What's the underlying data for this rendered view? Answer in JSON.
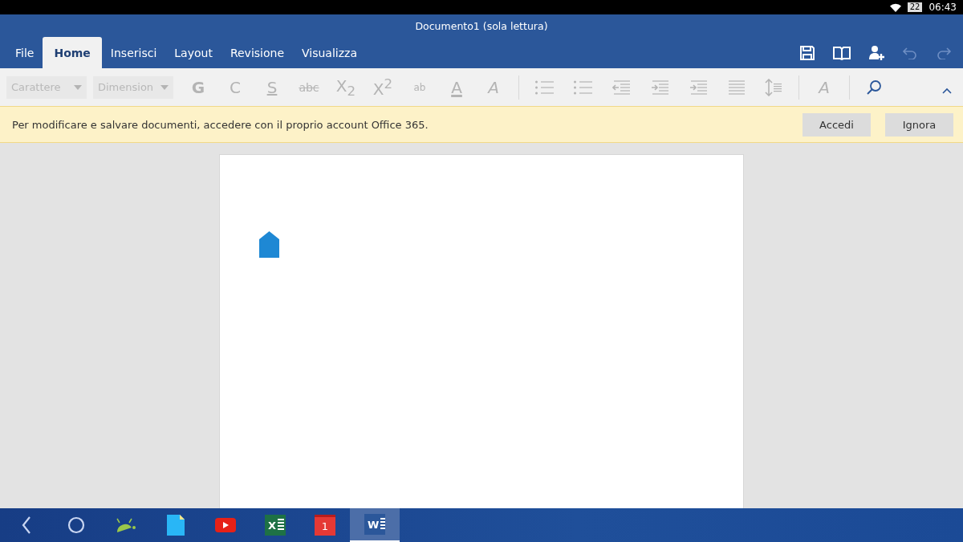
{
  "status_bar": {
    "battery": "22",
    "time": "06:43"
  },
  "window": {
    "title": "Documento1 (sola lettura)"
  },
  "tabs": [
    {
      "label": "File",
      "selected": false
    },
    {
      "label": "Home",
      "selected": true
    },
    {
      "label": "Inserisci",
      "selected": false
    },
    {
      "label": "Layout",
      "selected": false
    },
    {
      "label": "Revisione",
      "selected": false
    },
    {
      "label": "Visualizza",
      "selected": false
    }
  ],
  "quick_actions": [
    {
      "kind": "save",
      "disabled": false
    },
    {
      "kind": "read",
      "disabled": false
    },
    {
      "kind": "share",
      "disabled": false
    },
    {
      "kind": "undo",
      "disabled": true
    },
    {
      "kind": "redo",
      "disabled": true
    }
  ],
  "ribbon": {
    "font_box": {
      "placeholder": "Carattere"
    },
    "size_box": {
      "placeholder": "Dimension"
    },
    "commands": [
      {
        "kind": "bold",
        "label": "G",
        "disabled": true
      },
      {
        "kind": "italic",
        "label": "C",
        "disabled": true
      },
      {
        "kind": "underline",
        "label": "S",
        "disabled": true
      },
      {
        "kind": "strike",
        "label": "abc",
        "disabled": true
      },
      {
        "kind": "subscript",
        "label": "X$_{2}$",
        "disabled": true
      },
      {
        "kind": "superscript",
        "label": "X$^{2}$",
        "disabled": true
      },
      {
        "kind": "highlight",
        "label": "ab",
        "disabled": true
      },
      {
        "kind": "fontcolor",
        "label": "A",
        "disabled": true
      },
      {
        "kind": "clear",
        "label": "A",
        "disabled": true
      },
      {
        "kind": "sep"
      },
      {
        "kind": "bullets",
        "disabled": true
      },
      {
        "kind": "numbering",
        "disabled": true
      },
      {
        "kind": "outdent",
        "disabled": true
      },
      {
        "kind": "indent",
        "disabled": true
      },
      {
        "kind": "indent2",
        "disabled": true
      },
      {
        "kind": "align",
        "disabled": true
      },
      {
        "kind": "spacing",
        "disabled": true
      },
      {
        "kind": "sep"
      },
      {
        "kind": "styles",
        "label": "A",
        "disabled": true
      },
      {
        "kind": "sep"
      },
      {
        "kind": "search",
        "disabled": false
      }
    ]
  },
  "message_bar": {
    "text": "Per modificare e salvare documenti, accedere con il proprio account Office 365.",
    "buttons": [
      "Accedi",
      "Ignora"
    ]
  },
  "taskbar": [
    {
      "kind": "back",
      "selected": false
    },
    {
      "kind": "home",
      "selected": false
    },
    {
      "kind": "android",
      "selected": false
    },
    {
      "kind": "docs",
      "selected": false
    },
    {
      "kind": "youtube",
      "selected": false
    },
    {
      "kind": "excel",
      "label": "X",
      "selected": false
    },
    {
      "kind": "calendar",
      "label": "1",
      "selected": false
    },
    {
      "kind": "word",
      "label": "W",
      "selected": true
    }
  ]
}
